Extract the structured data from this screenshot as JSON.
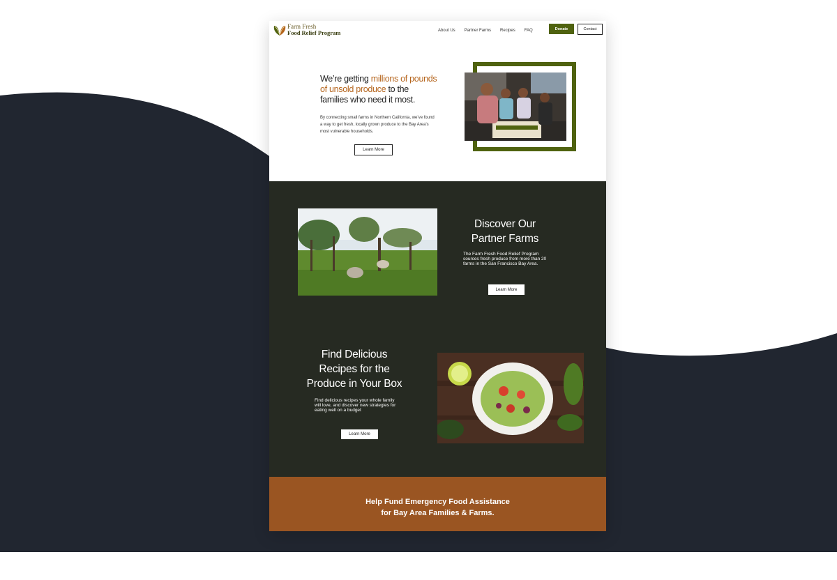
{
  "colors": {
    "backdrop_dark": "#212630",
    "brand_green": "#4f620f",
    "accent_orange": "#b5651d",
    "section_dark": "#262a22",
    "footer_orange": "#9a5522"
  },
  "header": {
    "logo_line1": "Farm Fresh",
    "logo_line2": "Food Relief Program",
    "logo_icon": "leaf-icon",
    "nav": [
      "About Us",
      "Partner Farms",
      "Recipes",
      "FAQ"
    ],
    "donate_label": "Donate",
    "contact_label": "Contact"
  },
  "hero": {
    "title_pre": "We’re getting ",
    "title_highlight": "millions of pounds of unsold produce",
    "title_post": " to the families who need it most.",
    "description": "By connecting small farms in Northern California, we’ve found a way to get fresh, locally grown produce to the Bay Area’s most vulnerable households.",
    "button_label": "Learn More"
  },
  "farms": {
    "title": "Discover Our Partner Farms",
    "description": "The Farm Fresh Food Relief Program sources fresh produce from more than 20 farms in the San Francisco Bay Area.",
    "button_label": "Learn More"
  },
  "recipes": {
    "title": "Find Delicious Recipes for the Produce in Your Box",
    "description": "Find delicious recipes your whole family will love, and discover new strategies for eating well on a budget",
    "button_label": "Learn More"
  },
  "fund": {
    "line1": "Help Fund Emergency Food Assistance",
    "line2": "for Bay Area Families & Farms."
  }
}
